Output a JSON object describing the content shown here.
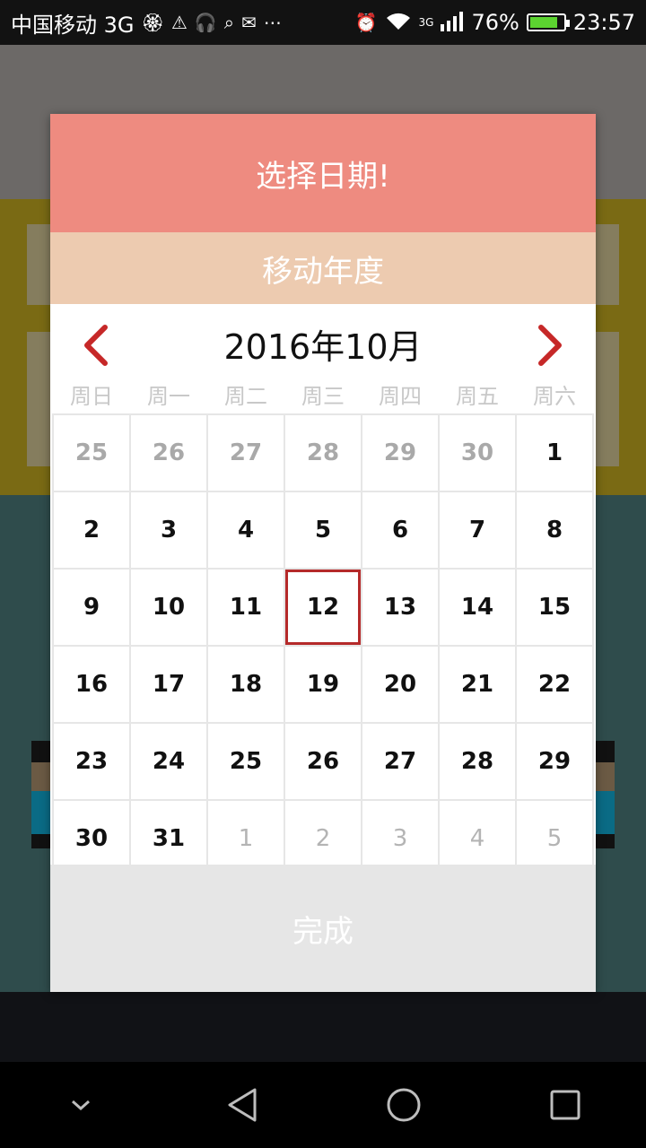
{
  "status_bar": {
    "carrier": "中国移动 3G",
    "network": "3G",
    "battery": "76%",
    "time": "23:57"
  },
  "dialog": {
    "title": "选择日期!",
    "subtitle": "移动年度",
    "month_label": "2016年10月",
    "weekdays": [
      "周日",
      "周一",
      "周二",
      "周三",
      "周四",
      "周五",
      "周六"
    ],
    "days": [
      {
        "d": "25",
        "muted": true
      },
      {
        "d": "26",
        "muted": true
      },
      {
        "d": "27",
        "muted": true
      },
      {
        "d": "28",
        "muted": true
      },
      {
        "d": "29",
        "muted": true
      },
      {
        "d": "30",
        "muted": true
      },
      {
        "d": "1"
      },
      {
        "d": "2"
      },
      {
        "d": "3"
      },
      {
        "d": "4"
      },
      {
        "d": "5"
      },
      {
        "d": "6"
      },
      {
        "d": "7"
      },
      {
        "d": "8"
      },
      {
        "d": "9"
      },
      {
        "d": "10"
      },
      {
        "d": "11"
      },
      {
        "d": "12",
        "selected": true
      },
      {
        "d": "13"
      },
      {
        "d": "14"
      },
      {
        "d": "15"
      },
      {
        "d": "16"
      },
      {
        "d": "17"
      },
      {
        "d": "18"
      },
      {
        "d": "19"
      },
      {
        "d": "20"
      },
      {
        "d": "21"
      },
      {
        "d": "22"
      },
      {
        "d": "23"
      },
      {
        "d": "24"
      },
      {
        "d": "25"
      },
      {
        "d": "26"
      },
      {
        "d": "27"
      },
      {
        "d": "28"
      },
      {
        "d": "29"
      },
      {
        "d": "30"
      },
      {
        "d": "31"
      },
      {
        "d": "1",
        "next": true
      },
      {
        "d": "2",
        "next": true
      },
      {
        "d": "3",
        "next": true
      },
      {
        "d": "4",
        "next": true
      },
      {
        "d": "5",
        "next": true
      }
    ],
    "done_label": "完成"
  },
  "colors": {
    "title_bg": "#ee8b80",
    "subtitle_bg": "#edcbb0",
    "arrow": "#c62828",
    "selected_border": "#b52a2a"
  },
  "icons": {
    "prev": "chevron-left-icon",
    "next": "chevron-right-icon",
    "nav_down": "chevron-down-icon",
    "nav_back": "triangle-back-icon",
    "nav_home": "circle-home-icon",
    "nav_recent": "square-recent-icon"
  }
}
